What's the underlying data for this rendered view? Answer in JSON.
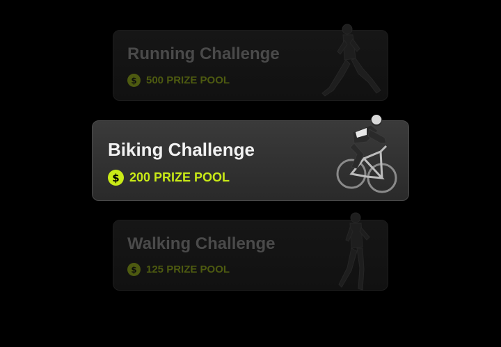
{
  "challenges": [
    {
      "title": "Running Challenge",
      "prize": "500 PRIZE POOL",
      "state": "inactive",
      "figure": "runner-figure"
    },
    {
      "title": "Biking Challenge",
      "prize": "200 PRIZE POOL",
      "state": "active",
      "figure": "cyclist-figure"
    },
    {
      "title": "Walking Challenge",
      "prize": "125 PRIZE POOL",
      "state": "inactive",
      "figure": "walker-figure"
    }
  ],
  "coin_symbol": "$",
  "colors": {
    "accent": "#c9ea17",
    "accent_dim": "#4d5a10",
    "background": "#000000",
    "active_card": "#333333",
    "inactive_card": "#141414"
  }
}
